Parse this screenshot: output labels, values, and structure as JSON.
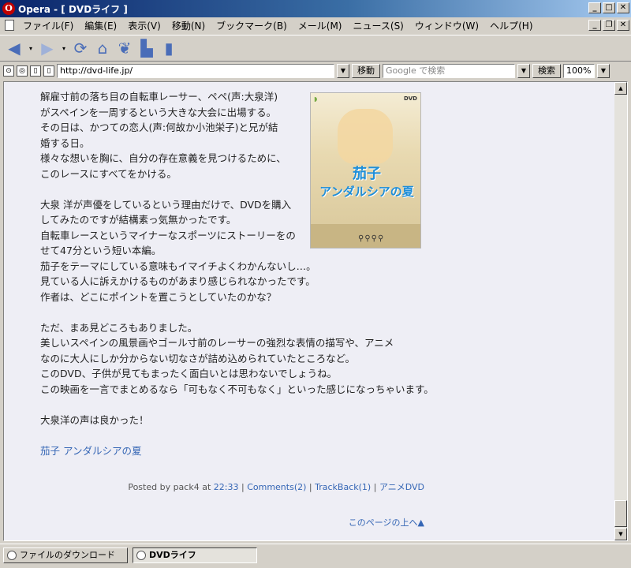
{
  "window": {
    "title": "Opera - [ DVDライフ ]",
    "app_icon": "O",
    "controls": {
      "minimize": "_",
      "maximize": "□",
      "close": "✕",
      "restore": "❐"
    }
  },
  "menu": {
    "items": [
      "ファイル(F)",
      "編集(E)",
      "表示(V)",
      "移動(N)",
      "ブックマーク(B)",
      "メール(M)",
      "ニュース(S)",
      "ウィンドウ(W)",
      "ヘルプ(H)"
    ]
  },
  "toolbar": {
    "back": "◀",
    "forward": "▶",
    "dropdown": "▾",
    "reload": "⟳",
    "home": "⌂",
    "hotlist": "❦",
    "print": "▙",
    "document": "▮"
  },
  "address_bar": {
    "url": "http://dvd-life.jp/",
    "go_label": "移動",
    "search_placeholder": "Google で検索",
    "search_label": "検索",
    "zoom": "100%",
    "dropdown": "▼"
  },
  "article": {
    "paragraphs": [
      [
        "解雇寸前の落ち目の自転車レーサー、ペペ(声:大泉洋)",
        "がスペインを一周するという大きな大会に出場する。",
        "その日は、かつての恋人(声:何故か小池栄子)と兄が結",
        "婚する日。",
        "様々な想いを胸に、自分の存在意義を見つけるために、",
        "このレースにすべてをかける。"
      ],
      [
        "大泉 洋が声優をしているという理由だけで、DVDを購入",
        "してみたのですが結構素っ気無かったです。",
        "自転車レースというマイナーなスポーツにストーリーをの",
        "せて47分という短い本編。",
        "茄子をテーマにしている意味もイマイチよくわかんないし…。",
        "見ている人に訴えかけるものがあまり感じられなかったです。",
        "作者は、どこにポイントを置こうとしていたのかな？"
      ],
      [
        "ただ、まあ見どころもありました。",
        "美しいスペインの風景画やゴール寸前のレーサーの強烈な表情の描写や、アニメ",
        "なのに大人にしか分からない切なさが詰め込められていたところなど。",
        "このDVD、子供が見てもまったく面白いとは思わないでしょうね。",
        "この映画を一言でまとめるなら「可もなく不可もなく」といった感じになっちゃいます。"
      ],
      [
        "大泉洋の声は良かった！"
      ]
    ],
    "product_link": "茄子 アンダルシアの夏",
    "cover": {
      "title_line1": "茄子",
      "title_line2": "アンダルシアの夏",
      "dvd_label": "DVD"
    },
    "footer": {
      "posted_by": "Posted by pack4 at",
      "time": "22:33",
      "sep": "|",
      "comments": "Comments(2)",
      "trackback": "TrackBack(1)",
      "category": "アニメDVD"
    },
    "page_top": "このページの上へ▲"
  },
  "scrollbar": {
    "up": "▲",
    "down": "▼"
  },
  "tabs": [
    {
      "label": "ファイルのダウンロード"
    },
    {
      "label": "DVDライフ",
      "active": true
    }
  ]
}
